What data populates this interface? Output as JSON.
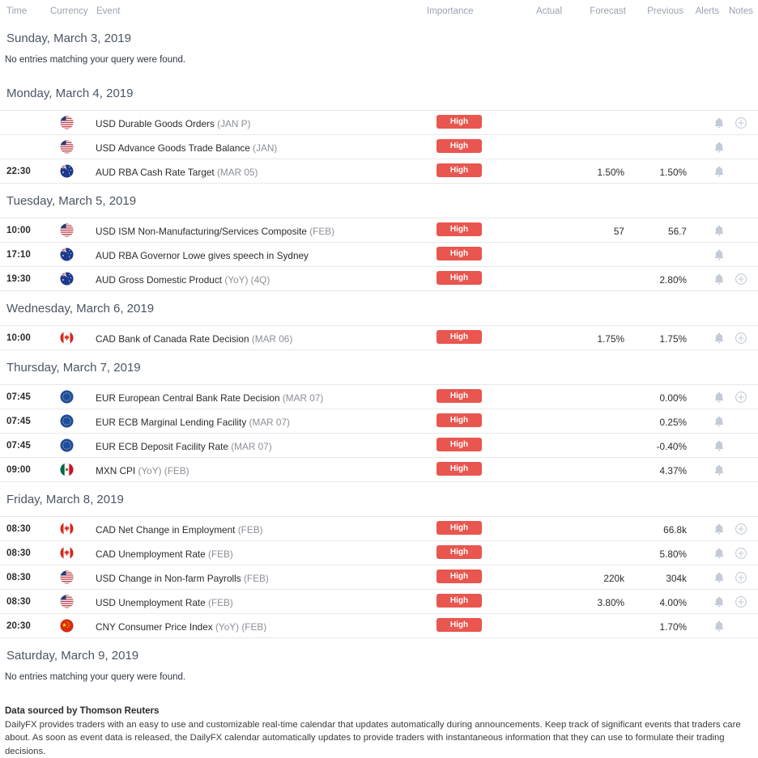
{
  "columns": {
    "time": "Time",
    "currency": "Currency",
    "event": "Event",
    "importance": "Importance",
    "actual": "Actual",
    "forecast": "Forecast",
    "previous": "Previous",
    "alerts": "Alerts",
    "notes": "Notes"
  },
  "empty_message": "No entries matching your query were found.",
  "accent_color": "#e8564f",
  "days": [
    {
      "date": "Sunday, March 3, 2019",
      "empty": true,
      "events": []
    },
    {
      "date": "Monday, March 4, 2019",
      "empty": false,
      "events": [
        {
          "time": "",
          "flag": "us-flag-icon",
          "currency": "USD",
          "name": "Durable Goods Orders",
          "paren": "(JAN P)",
          "importance": "High",
          "actual": "",
          "forecast": "",
          "previous": "",
          "alert": true,
          "note": true
        },
        {
          "time": "",
          "flag": "us-flag-icon",
          "currency": "USD",
          "name": "Advance Goods Trade Balance",
          "paren": "(JAN)",
          "importance": "High",
          "actual": "",
          "forecast": "",
          "previous": "",
          "alert": true,
          "note": false
        },
        {
          "time": "22:30",
          "flag": "au-flag-icon",
          "currency": "AUD",
          "name": "RBA Cash Rate Target",
          "paren": "(MAR 05)",
          "importance": "High",
          "actual": "",
          "forecast": "1.50%",
          "previous": "1.50%",
          "alert": true,
          "note": false
        }
      ]
    },
    {
      "date": "Tuesday, March 5, 2019",
      "empty": false,
      "events": [
        {
          "time": "10:00",
          "flag": "us-flag-icon",
          "currency": "USD",
          "name": "ISM Non-Manufacturing/Services Composite",
          "paren": "(FEB)",
          "importance": "High",
          "actual": "",
          "forecast": "57",
          "previous": "56.7",
          "alert": true,
          "note": false
        },
        {
          "time": "17:10",
          "flag": "au-flag-icon",
          "currency": "AUD",
          "name": "RBA Governor Lowe gives speech in Sydney",
          "paren": "",
          "importance": "High",
          "actual": "",
          "forecast": "",
          "previous": "",
          "alert": true,
          "note": false
        },
        {
          "time": "19:30",
          "flag": "au-flag-icon",
          "currency": "AUD",
          "name": "Gross Domestic Product",
          "paren": "(YoY) (4Q)",
          "importance": "High",
          "actual": "",
          "forecast": "",
          "previous": "2.80%",
          "alert": true,
          "note": true
        }
      ]
    },
    {
      "date": "Wednesday, March 6, 2019",
      "empty": false,
      "events": [
        {
          "time": "10:00",
          "flag": "ca-flag-icon",
          "currency": "CAD",
          "name": "Bank of Canada Rate Decision",
          "paren": "(MAR 06)",
          "importance": "High",
          "actual": "",
          "forecast": "1.75%",
          "previous": "1.75%",
          "alert": true,
          "note": true
        }
      ]
    },
    {
      "date": "Thursday, March 7, 2019",
      "empty": false,
      "events": [
        {
          "time": "07:45",
          "flag": "eu-flag-icon",
          "currency": "EUR",
          "name": "European Central Bank Rate Decision",
          "paren": "(MAR 07)",
          "importance": "High",
          "actual": "",
          "forecast": "",
          "previous": "0.00%",
          "alert": true,
          "note": true
        },
        {
          "time": "07:45",
          "flag": "eu-flag-icon",
          "currency": "EUR",
          "name": "ECB Marginal Lending Facility",
          "paren": "(MAR 07)",
          "importance": "High",
          "actual": "",
          "forecast": "",
          "previous": "0.25%",
          "alert": true,
          "note": false
        },
        {
          "time": "07:45",
          "flag": "eu-flag-icon",
          "currency": "EUR",
          "name": "ECB Deposit Facility Rate",
          "paren": "(MAR 07)",
          "importance": "High",
          "actual": "",
          "forecast": "",
          "previous": "-0.40%",
          "alert": true,
          "note": false
        },
        {
          "time": "09:00",
          "flag": "mx-flag-icon",
          "currency": "MXN",
          "name": "CPI",
          "paren": "(YoY) (FEB)",
          "importance": "High",
          "actual": "",
          "forecast": "",
          "previous": "4.37%",
          "alert": true,
          "note": false
        }
      ]
    },
    {
      "date": "Friday, March 8, 2019",
      "empty": false,
      "events": [
        {
          "time": "08:30",
          "flag": "ca-flag-icon",
          "currency": "CAD",
          "name": "Net Change in Employment",
          "paren": "(FEB)",
          "importance": "High",
          "actual": "",
          "forecast": "",
          "previous": "66.8k",
          "alert": true,
          "note": true
        },
        {
          "time": "08:30",
          "flag": "ca-flag-icon",
          "currency": "CAD",
          "name": "Unemployment Rate",
          "paren": "(FEB)",
          "importance": "High",
          "actual": "",
          "forecast": "",
          "previous": "5.80%",
          "alert": true,
          "note": true
        },
        {
          "time": "08:30",
          "flag": "us-flag-icon",
          "currency": "USD",
          "name": "Change in Non-farm Payrolls",
          "paren": "(FEB)",
          "importance": "High",
          "actual": "",
          "forecast": "220k",
          "previous": "304k",
          "alert": true,
          "note": true
        },
        {
          "time": "08:30",
          "flag": "us-flag-icon",
          "currency": "USD",
          "name": "Unemployment Rate",
          "paren": "(FEB)",
          "importance": "High",
          "actual": "",
          "forecast": "3.80%",
          "previous": "4.00%",
          "alert": true,
          "note": true
        },
        {
          "time": "20:30",
          "flag": "cn-flag-icon",
          "currency": "CNY",
          "name": "Consumer Price Index",
          "paren": "(YoY) (FEB)",
          "importance": "High",
          "actual": "",
          "forecast": "",
          "previous": "1.70%",
          "alert": true,
          "note": false
        }
      ]
    },
    {
      "date": "Saturday, March 9, 2019",
      "empty": true,
      "events": []
    }
  ],
  "footer": {
    "title": "Data sourced by Thomson Reuters",
    "text": "DailyFX provides traders with an easy to use and customizable real-time calendar that updates automatically during announcements. Keep track of significant events that traders care about. As soon as event data is released, the DailyFX calendar automatically updates to provide traders with instantaneous information that they can use to formulate their trading decisions."
  }
}
